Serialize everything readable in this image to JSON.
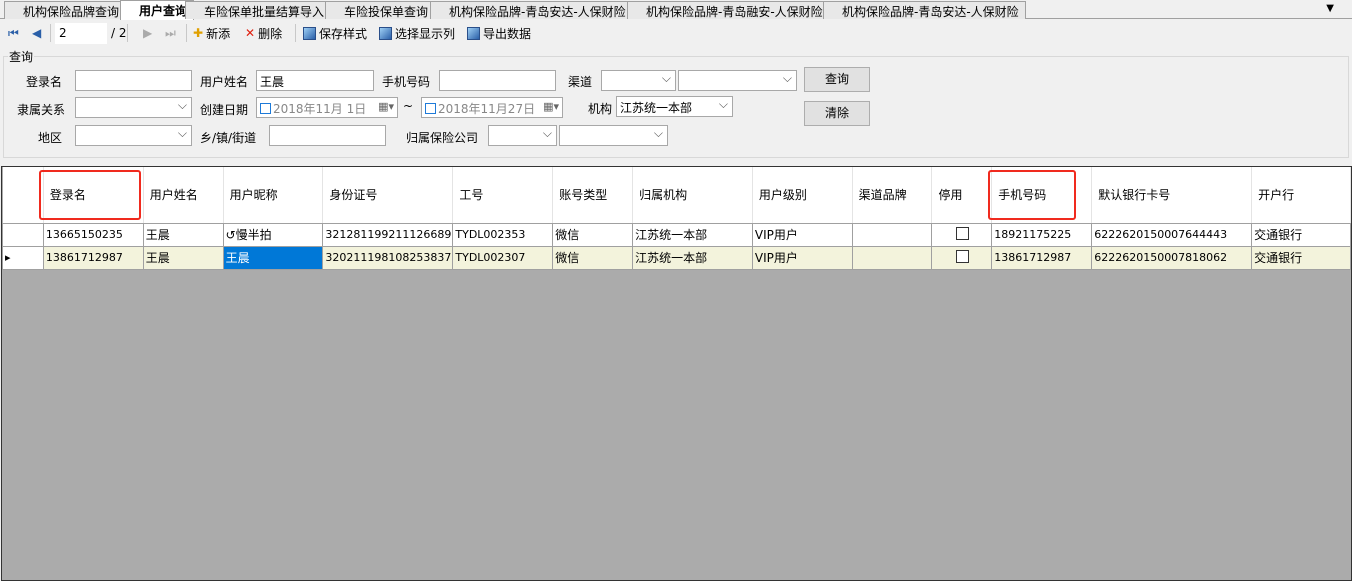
{
  "tabs": [
    "机构保险品牌查询",
    "用户查询",
    "车险保单批量结算导入",
    "车险投保单查询",
    "机构保险品牌-青岛安达-人保财险",
    "机构保险品牌-青岛融安-人保财险",
    "机构保险品牌-青岛安达-人保财险"
  ],
  "toolbar": {
    "page": "2",
    "total": "/ 2",
    "add": "新添",
    "delete": "删除",
    "save_style": "保存样式",
    "choose_cols": "选择显示列",
    "export": "导出数据"
  },
  "query": {
    "title": "查询",
    "login_label": "登录名",
    "login": "",
    "username_label": "用户姓名",
    "username": "王晨",
    "phone_label": "手机号码",
    "phone": "",
    "channel_label": "渠道",
    "relation_label": "隶属关系",
    "created_label": "创建日期",
    "date_from": "2018年11月 1日",
    "tilde": "~",
    "date_to": "2018年11月27日",
    "org_label": "机构",
    "org": "江苏统一本部",
    "region_label": "地区",
    "town_label": "乡/镇/街道",
    "town": "",
    "insurer_label": "归属保险公司",
    "search_btn": "查询",
    "clear_btn": "清除"
  },
  "grid": {
    "columns": [
      "登录名",
      "用户姓名",
      "用户昵称",
      "身份证号",
      "工号",
      "账号类型",
      "归属机构",
      "用户级别",
      "渠道品牌",
      "停用",
      "手机号码",
      "默认银行卡号",
      "开户行"
    ],
    "rows": [
      [
        "13665150235",
        "王晨",
        "↺慢半拍",
        "321281199211126689",
        "TYDL002353",
        "微信",
        "江苏统一本部",
        "VIP用户",
        "",
        false,
        "18921175225",
        "6222620150007644443",
        "交通银行"
      ],
      [
        "13861712987",
        "王晨",
        "王晨",
        "320211198108253837",
        "TYDL002307",
        "微信",
        "江苏统一本部",
        "VIP用户",
        "",
        false,
        "13861712987",
        "6222620150007818062",
        "交通银行"
      ]
    ]
  }
}
